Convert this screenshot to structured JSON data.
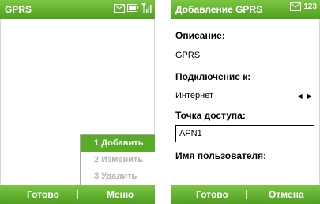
{
  "screen1": {
    "title": "GPRS",
    "menu": {
      "items": [
        {
          "label": "1 Добавить",
          "state": "selected"
        },
        {
          "label": "2 Изменить",
          "state": "disabled"
        },
        {
          "label": "3 Удалить",
          "state": "disabled"
        }
      ]
    },
    "softkeys": {
      "left": "Готово",
      "right": "Меню"
    }
  },
  "screen2": {
    "title": "Добавление GPRS",
    "status_text": "123",
    "fields": {
      "description_label": "Описание:",
      "description_value": "GPRS",
      "connect_label": "Подключение к:",
      "connect_value": "Интернет",
      "access_point_label": "Точка доступа:",
      "access_point_value": "APN1",
      "username_label": "Имя пользователя:"
    },
    "softkeys": {
      "left": "Готово",
      "right": "Отмена"
    }
  },
  "colors": {
    "accent": "#5aab2a"
  }
}
